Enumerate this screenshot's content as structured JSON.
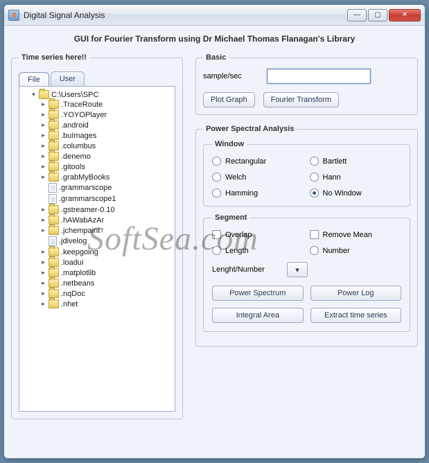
{
  "window": {
    "title": "Digital Signal Analysis"
  },
  "header": {
    "subtitle": "GUI for Fourier Transform  using Dr Michael Thomas Flanagan's Library"
  },
  "tree_panel": {
    "legend": "Time series here!!",
    "tabs": [
      "File",
      "User"
    ],
    "active_tab": 0,
    "root": "C:\\Users\\SPC",
    "items": [
      {
        "t": "folder",
        "n": ".TraceRoute"
      },
      {
        "t": "folder",
        "n": ".YOYOPlayer"
      },
      {
        "t": "folder",
        "n": ".android"
      },
      {
        "t": "folder",
        "n": ".buImages"
      },
      {
        "t": "folder",
        "n": ".columbus"
      },
      {
        "t": "folder",
        "n": ".denemo"
      },
      {
        "t": "folder",
        "n": ".gitools"
      },
      {
        "t": "folder",
        "n": ".grabMyBooks"
      },
      {
        "t": "file",
        "n": ".grammarscope"
      },
      {
        "t": "file",
        "n": ".grammarscope1"
      },
      {
        "t": "folder",
        "n": ".gstreamer-0.10"
      },
      {
        "t": "folder",
        "n": ".hAWabAzAr"
      },
      {
        "t": "folder",
        "n": ".jchempaint"
      },
      {
        "t": "file",
        "n": ".jdivelog"
      },
      {
        "t": "folder",
        "n": ".keepgoing"
      },
      {
        "t": "folder",
        "n": ".loadui"
      },
      {
        "t": "folder",
        "n": ".matplotlib"
      },
      {
        "t": "folder",
        "n": ".netbeans"
      },
      {
        "t": "folder",
        "n": ".nqDoc"
      },
      {
        "t": "folder",
        "n": ".nhet"
      }
    ]
  },
  "basic": {
    "legend": "Basic",
    "sample_label": "sample/sec",
    "sample_value": "",
    "plot_btn": "Plot Graph",
    "ft_btn": "Fourier Transform"
  },
  "psa": {
    "legend": "Power Spectral Analysis",
    "window": {
      "legend": "Window",
      "options": [
        "Rectangular",
        "Bartlett",
        "Welch",
        "Hann",
        "Hamming",
        "No Window"
      ],
      "selected": 5
    },
    "segment": {
      "legend": "Segment",
      "overlap": "Overlap",
      "remove_mean": "Remove Mean",
      "length_radio": "Length",
      "number_radio": "Number",
      "ln_label": "Lenght/Number",
      "btn_ps": "Power Spectrum",
      "btn_pl": "Power Log",
      "btn_ia": "Integral Area",
      "btn_ets": "Extract time series"
    }
  },
  "watermark": "SoftSea.com"
}
